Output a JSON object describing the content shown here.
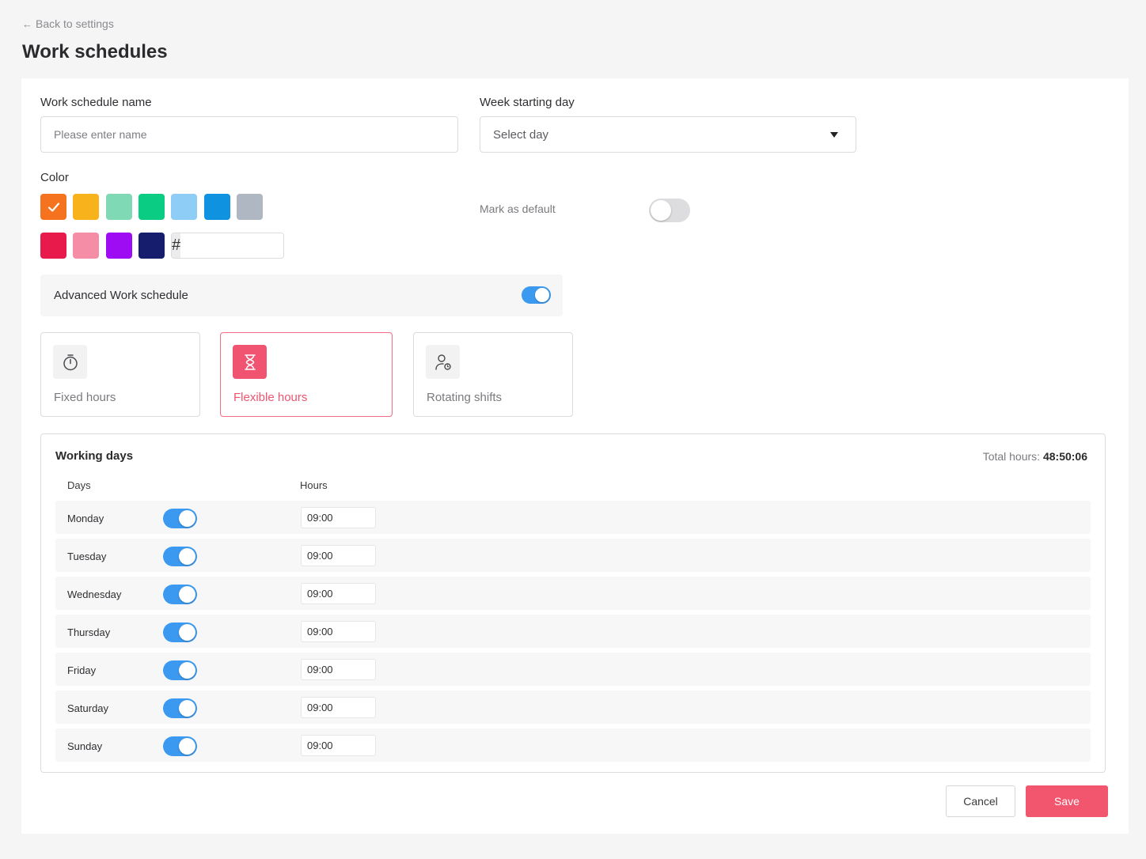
{
  "header": {
    "back_label": "Back to settings",
    "title": "Work schedules"
  },
  "form": {
    "name_label": "Work schedule name",
    "name_placeholder": "Please enter name",
    "week_label": "Week starting day",
    "week_value": "Select day",
    "color_label": "Color",
    "hex_symbol": "#",
    "colors": [
      "#f5731f",
      "#f8b21c",
      "#7fd9b4",
      "#0acc82",
      "#8ecdf5",
      "#0f93e0",
      "#aeb7c2",
      "#e8194b",
      "#f58da7",
      "#9d0cf2",
      "#161d6d"
    ],
    "selected_color": "#f5731f",
    "mark_default_label": "Mark as default",
    "mark_default_on": false,
    "advanced_label": "Advanced Work schedule",
    "advanced_on": true
  },
  "modes": [
    {
      "label": "Fixed hours",
      "icon": "stopwatch-icon",
      "active": false
    },
    {
      "label": "Flexible hours",
      "icon": "hourglass-icon",
      "active": true
    },
    {
      "label": "Rotating shifts",
      "icon": "user-clock-icon",
      "active": false
    }
  ],
  "working_days": {
    "title": "Working days",
    "total_label": "Total hours:",
    "total_value": "48:50:06",
    "col_days": "Days",
    "col_hours": "Hours",
    "days": [
      {
        "name": "Monday",
        "enabled": true,
        "hours": "09:00"
      },
      {
        "name": "Tuesday",
        "enabled": true,
        "hours": "09:00"
      },
      {
        "name": "Wednesday",
        "enabled": true,
        "hours": "09:00"
      },
      {
        "name": "Thursday",
        "enabled": true,
        "hours": "09:00"
      },
      {
        "name": "Friday",
        "enabled": true,
        "hours": "09:00"
      },
      {
        "name": "Saturday",
        "enabled": true,
        "hours": "09:00"
      },
      {
        "name": "Sunday",
        "enabled": true,
        "hours": "09:00"
      }
    ]
  },
  "actions": {
    "cancel_label": "Cancel",
    "save_label": "Save"
  },
  "theme": {
    "toggle_on": "#3b99f0",
    "toggle_off": "#dddde0",
    "accent": "#f2566f"
  }
}
